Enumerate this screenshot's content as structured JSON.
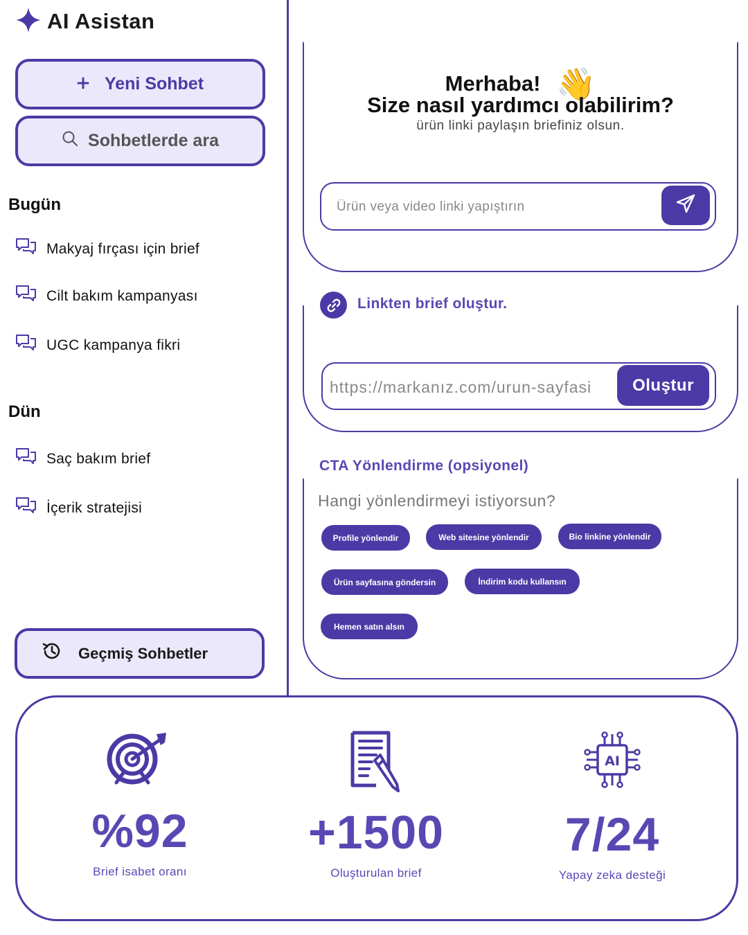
{
  "app": {
    "title": "AI Asistan",
    "accent_color": "#4b3aa5",
    "accent_light": "#ece8fb"
  },
  "sidebar": {
    "new_chat_label": "Yeni Sohbet",
    "new_chat_icon": "plus-icon",
    "search_label": "Sohbetlerde ara",
    "search_icon": "search-icon",
    "sections": [
      {
        "title": "Bugün",
        "items": [
          {
            "label": "Makyaj fırçası için brief",
            "icon": "chat-bubbles-icon"
          },
          {
            "label": "Cilt bakım kampanyası",
            "icon": "chat-bubbles-icon"
          },
          {
            "label": "UGC kampanya fikri",
            "icon": "chat-bubbles-icon"
          }
        ]
      },
      {
        "title": "Dün",
        "items": [
          {
            "label": "Saç bakım brief",
            "icon": "chat-bubbles-icon"
          },
          {
            "label": "İçerik stratejisi",
            "icon": "chat-bubbles-icon"
          }
        ]
      }
    ],
    "history_label": "Geçmiş Sohbetler",
    "history_icon": "history-icon"
  },
  "main": {
    "greeting": {
      "line1": "Merhaba!",
      "emoji": "👋",
      "line2": "Size nasıl yardımcı olabilirim?",
      "subtitle": "ürün linki paylaşın briefiniz olsun."
    },
    "link_input": {
      "placeholder": "Ürün veya video linki yapıştırın",
      "send_icon": "send-icon"
    },
    "brief_from_link": {
      "title": "Linkten brief oluştur.",
      "icon": "link-icon",
      "placeholder": "https://markanız.com/urun-sayfasi",
      "button_label": "Oluştur"
    },
    "cta": {
      "title": "CTA Yönlendirme (opsiyonel)",
      "question": "Hangi yönlendirmeyi istiyorsun?",
      "options": [
        "Profile yönlendir",
        "Web sitesine yönlendir",
        "Bio linkine yönlendir",
        "Ürün sayfasına göndersin",
        "İndirim kodu kullansın",
        "Hemen satın alsın"
      ]
    }
  },
  "stats": [
    {
      "value": "%92",
      "label": "Brief isabet oranı",
      "icon": "target-icon"
    },
    {
      "value": "+1500",
      "label": "Oluşturulan brief",
      "icon": "document-pen-icon"
    },
    {
      "value": "7/24",
      "label": "Yapay zeka desteği",
      "icon": "ai-chip-icon"
    }
  ]
}
